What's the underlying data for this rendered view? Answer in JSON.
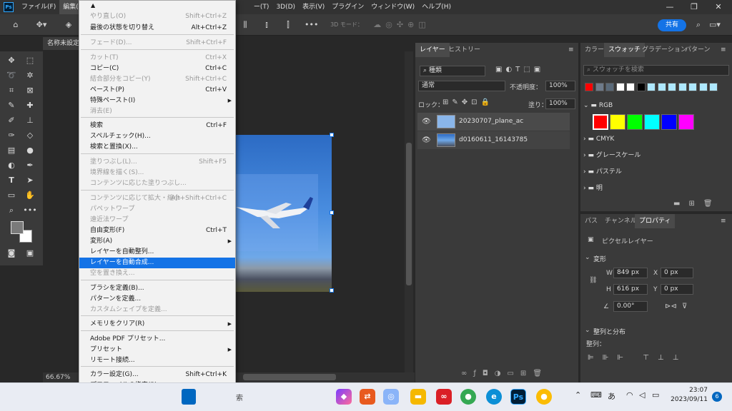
{
  "menubar": {
    "logo": "Ps",
    "items": [
      "ファイル(F)",
      "編集(E)",
      "ー(T)",
      "3D(D)",
      "表示(V)",
      "プラグイン",
      "ウィンドウ(W)",
      "ヘルプ(H)"
    ],
    "minimize": "—",
    "maximize": "❐",
    "close": "✕"
  },
  "options": {
    "mode_label": "3D モード：",
    "share_label": "共有"
  },
  "document": {
    "tab_title": "名称未設定",
    "zoom": "66.67%"
  },
  "edit_menu": {
    "items": [
      {
        "label": "やり直し(O)",
        "shortcut": "Shift+Ctrl+Z",
        "disabled": true
      },
      {
        "label": "最後の状態を切り替え",
        "shortcut": "Alt+Ctrl+Z",
        "disabled": false
      },
      {
        "label": "フェード(D)...",
        "shortcut": "Shift+Ctrl+F",
        "disabled": true
      },
      {
        "label": "カット(T)",
        "shortcut": "Ctrl+X",
        "disabled": true
      },
      {
        "label": "コピー(C)",
        "shortcut": "Ctrl+C",
        "disabled": false
      },
      {
        "label": "結合部分をコピー(Y)",
        "shortcut": "Shift+Ctrl+C",
        "disabled": true
      },
      {
        "label": "ペースト(P)",
        "shortcut": "Ctrl+V",
        "disabled": false
      },
      {
        "label": "特殊ペースト(I)",
        "shortcut": "",
        "disabled": false,
        "submenu": true
      },
      {
        "label": "消去(E)",
        "shortcut": "",
        "disabled": true
      },
      {
        "label": "検索",
        "shortcut": "Ctrl+F",
        "disabled": false
      },
      {
        "label": "スペルチェック(H)...",
        "shortcut": "",
        "disabled": false
      },
      {
        "label": "検索と置換(X)...",
        "shortcut": "",
        "disabled": false
      },
      {
        "label": "塗りつぶし(L)...",
        "shortcut": "Shift+F5",
        "disabled": true
      },
      {
        "label": "境界線を描く(S)...",
        "shortcut": "",
        "disabled": true
      },
      {
        "label": "コンテンツに応じた塗りつぶし...",
        "shortcut": "",
        "disabled": true
      },
      {
        "label": "コンテンツに応じて拡大・縮小",
        "shortcut": "Alt+Shift+Ctrl+C",
        "disabled": true
      },
      {
        "label": "パペットワープ",
        "shortcut": "",
        "disabled": true
      },
      {
        "label": "遠近法ワープ",
        "shortcut": "",
        "disabled": true
      },
      {
        "label": "自由変形(F)",
        "shortcut": "Ctrl+T",
        "disabled": false
      },
      {
        "label": "変形(A)",
        "shortcut": "",
        "disabled": false,
        "submenu": true
      },
      {
        "label": "レイヤーを自動整列...",
        "shortcut": "",
        "disabled": false
      },
      {
        "label": "レイヤーを自動合成...",
        "shortcut": "",
        "disabled": false,
        "highlight": true
      },
      {
        "label": "空を置き換え...",
        "shortcut": "",
        "disabled": true
      },
      {
        "label": "ブラシを定義(B)...",
        "shortcut": "",
        "disabled": false
      },
      {
        "label": "パターンを定義...",
        "shortcut": "",
        "disabled": false
      },
      {
        "label": "カスタムシェイプを定義...",
        "shortcut": "",
        "disabled": true
      },
      {
        "label": "メモリをクリア(R)",
        "shortcut": "",
        "disabled": false,
        "submenu": true
      },
      {
        "label": "Adobe PDF プリセット...",
        "shortcut": "",
        "disabled": false
      },
      {
        "label": "プリセット",
        "shortcut": "",
        "disabled": false,
        "submenu": true
      },
      {
        "label": "リモート接続...",
        "shortcut": "",
        "disabled": false
      },
      {
        "label": "カラー設定(G)...",
        "shortcut": "Shift+Ctrl+K",
        "disabled": false
      },
      {
        "label": "プロファイルの指定(P)...",
        "shortcut": "",
        "disabled": false
      }
    ]
  },
  "layers_panel": {
    "tabs": [
      "レイヤー",
      "ヒストリー"
    ],
    "filter_label": "種類",
    "blend_mode": "通常",
    "opacity_label": "不透明度：",
    "opacity_value": "100%",
    "lock_label": "ロック：",
    "fill_label": "塗り：",
    "fill_value": "100%",
    "layers": [
      {
        "name": "20230707_plane_ac"
      },
      {
        "name": "d0160611_16143785"
      }
    ]
  },
  "swatch_panel": {
    "tabs": [
      "カラー",
      "スウォッチ",
      "グラデーション",
      "パターン"
    ],
    "search_placeholder": "スウォッチを検索",
    "top_colors": [
      "#ff0000",
      "#6e7b8b",
      "#5a6a7a",
      "#ffffff",
      "#ffffff",
      "#000000",
      "#aee8ff",
      "#aee8ff",
      "#aee8ff",
      "#aee8ff",
      "#aee8ff",
      "#aee8ff",
      "#aee8ff"
    ],
    "rgb_colors": [
      "#ff0000",
      "#ffff00",
      "#00ff00",
      "#00ffff",
      "#0000ff",
      "#ff00ff"
    ],
    "folders": [
      "RGB",
      "CMYK",
      "グレースケール",
      "パステル",
      "明"
    ]
  },
  "props_panel": {
    "tabs": [
      "パス",
      "チャンネル",
      "プロパティ"
    ],
    "layer_type": "ピクセルレイヤー",
    "transform_title": "変形",
    "w_label": "W",
    "w_value": "849 px",
    "x_label": "X",
    "x_value": "0 px",
    "h_label": "H",
    "h_value": "616 px",
    "y_label": "Y",
    "y_value": "0 px",
    "angle_value": "0.00°",
    "align_title": "整列と分布",
    "align_label": "整列："
  },
  "taskbar": {
    "search_fragment": "索",
    "time": "23:07",
    "date": "2023/09/11",
    "ime": "あ",
    "notifications": "6"
  }
}
